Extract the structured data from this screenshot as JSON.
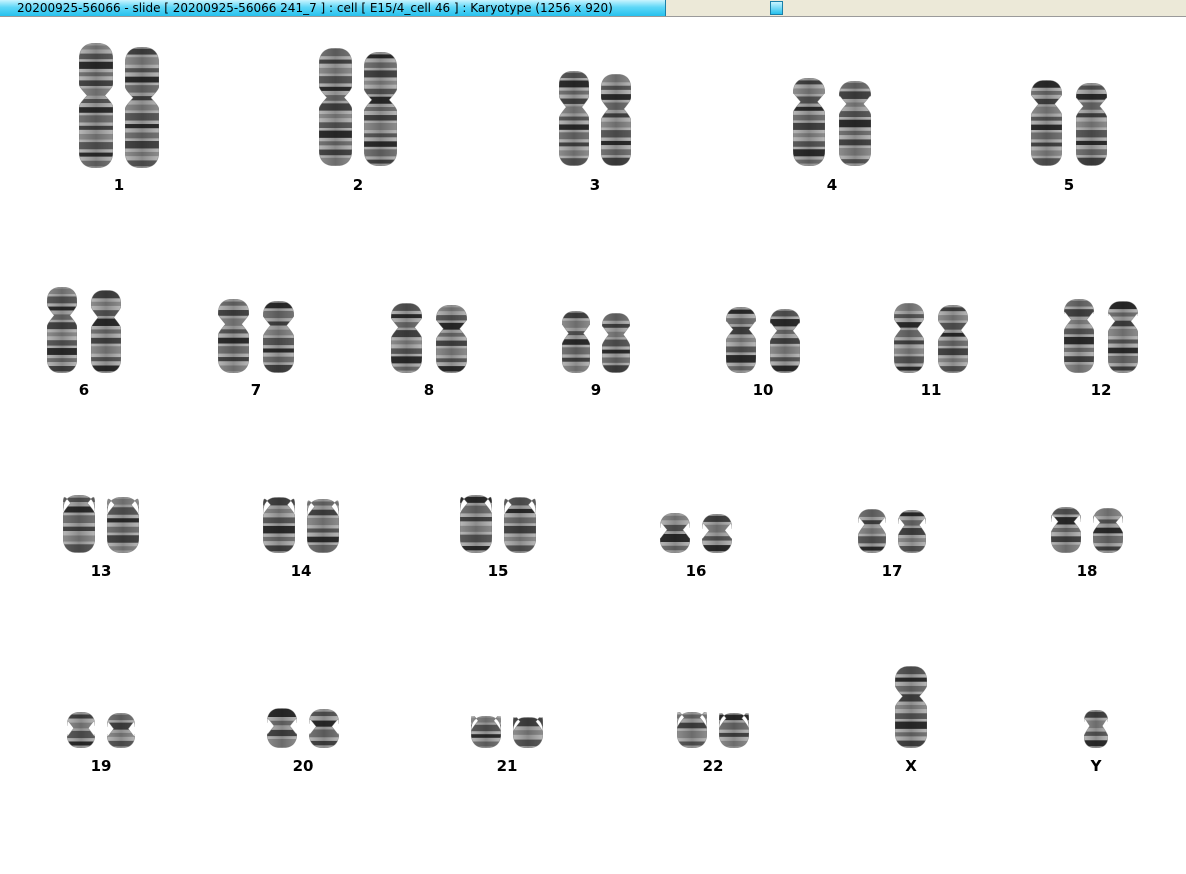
{
  "window": {
    "title": "20200925-56066 - slide [ 20200925-56066 241_7 ] : cell [ E15/4_cell 46 ] : Karyotype  (1256 x 920)"
  },
  "karyotype": {
    "chromosomes": [
      {
        "label": "1",
        "count": 2
      },
      {
        "label": "2",
        "count": 2
      },
      {
        "label": "3",
        "count": 2
      },
      {
        "label": "4",
        "count": 2
      },
      {
        "label": "5",
        "count": 2
      },
      {
        "label": "6",
        "count": 2
      },
      {
        "label": "7",
        "count": 2
      },
      {
        "label": "8",
        "count": 2
      },
      {
        "label": "9",
        "count": 2
      },
      {
        "label": "10",
        "count": 2
      },
      {
        "label": "11",
        "count": 2
      },
      {
        "label": "12",
        "count": 2
      },
      {
        "label": "13",
        "count": 2
      },
      {
        "label": "14",
        "count": 2
      },
      {
        "label": "15",
        "count": 2
      },
      {
        "label": "16",
        "count": 2
      },
      {
        "label": "17",
        "count": 2
      },
      {
        "label": "18",
        "count": 2
      },
      {
        "label": "19",
        "count": 2
      },
      {
        "label": "20",
        "count": 2
      },
      {
        "label": "21",
        "count": 2
      },
      {
        "label": "22",
        "count": 2
      },
      {
        "label": "X",
        "count": 1
      },
      {
        "label": "Y",
        "count": 1
      }
    ]
  }
}
